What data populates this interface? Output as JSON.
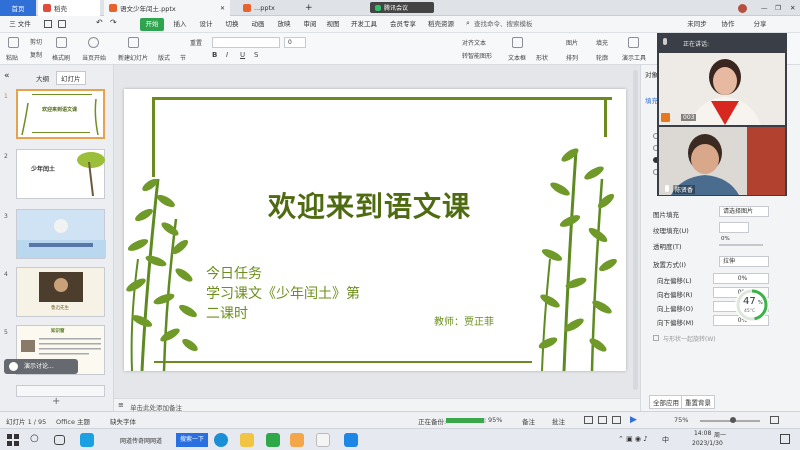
{
  "tabs": [
    {
      "label": "首页",
      "color": "#2f6fd6",
      "active": true
    },
    {
      "label": "稻壳",
      "color": "#e24a3b"
    },
    {
      "label": "语文少年闰土.pptx",
      "color": "#e8622a"
    },
    {
      "label": "...pptx",
      "color": "#e8622a"
    }
  ],
  "tab_plus": "+",
  "meeting_badge": "腾讯会议",
  "window_controls": {
    "min": "—",
    "max": "❐",
    "close": "✕"
  },
  "menu": {
    "file": "三 文件",
    "items": [
      "开始",
      "插入",
      "设计",
      "切换",
      "动画",
      "放映",
      "审阅",
      "视图",
      "开发工具",
      "会员专享",
      "稻壳资源"
    ],
    "active_item": "开始",
    "search": "查找命令、搜索模板",
    "right": [
      "未同步",
      "协作",
      "分享"
    ]
  },
  "ribbon": {
    "paste": "粘贴",
    "cut": "剪切",
    "copy": "复制",
    "format_painter": "格式刷",
    "play_from_current": "当页开始",
    "new_slide": "新建幻灯片",
    "layout": "版式",
    "section": "节",
    "reset": "重置",
    "font_size": "0",
    "bold": "B",
    "italic": "I",
    "underline": "U",
    "strike": "S",
    "align_text": "对齐文本",
    "convert_smartart": "转智能图形",
    "textbox": "文本框",
    "shape": "形状",
    "arrange": "排列",
    "outline": "轮廓",
    "picture": "图片",
    "fill": "填充",
    "slideshow_tools": "演示工具"
  },
  "left_panel": {
    "tab_outline": "大纲",
    "tab_slides": "幻灯片",
    "collapse": "«",
    "thumbnails": [
      {
        "num": "1",
        "title": "欢迎来到语文课",
        "active": true
      },
      {
        "num": "2",
        "title": "少年闰土"
      },
      {
        "num": "3",
        "title": ""
      },
      {
        "num": "4",
        "title": "鲁迅先生"
      },
      {
        "num": "5",
        "title": "知识窗"
      }
    ],
    "floating_hint": "演示讨论...",
    "add": "+"
  },
  "slide": {
    "title": "欢迎来到语文课",
    "task_line1": "今日任务",
    "task_line2": "学习课文《少年闰土》第",
    "task_line3": "二课时",
    "teacher": "教师：贾正菲"
  },
  "notes_placeholder": "单击此处添加备注",
  "video": {
    "speaking_label": "正在讲话:",
    "participant1_name": "003",
    "participant2_name": "陈贤香"
  },
  "right_panel": {
    "tab": "对象",
    "tab2": "填充",
    "picture_fill": "图片填充",
    "picture_fill_value": "请选择图片",
    "texture_fill": "纹理填充(U)",
    "transparency": "透明度(T)",
    "transparency_value": "0%",
    "stretch_mode": "放置方式(I)",
    "stretch_value": "拉伸",
    "offset_left": "向左偏移(L)",
    "offset_right": "向右偏移(R)",
    "offset_up": "向上偏移(O)",
    "offset_down": "向下偏移(M)",
    "offset_value": "0%",
    "rotate_with_shape": "与形状一起旋转(W)",
    "apply_all": "全部应用",
    "reset_bg": "重置背景",
    "gauge_percent": "47",
    "gauge_sub": "45°C",
    "gauge_fraction": 0.47
  },
  "status": {
    "slide_count": "幻灯片 1 / 95",
    "theme": "Office 主题",
    "missing_font": "缺失字体",
    "backup": "正在备份:",
    "backup_percent": "95%",
    "backup_fraction": 0.95,
    "notes": "备注",
    "comments": "批注",
    "zoom": "75%"
  },
  "taskbar": {
    "app_label": "网道传奇网网道",
    "search_btn": "搜索一下",
    "time": "14:08",
    "day": "周一",
    "date": "2023/1/30",
    "lang": "中"
  }
}
